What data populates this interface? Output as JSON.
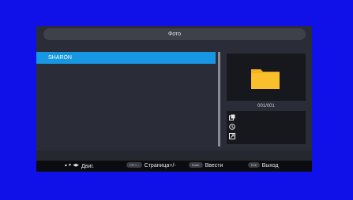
{
  "colors": {
    "background": "#1010e8",
    "panel": "#2a2d37",
    "selection": "#1696e3",
    "folder": "#f6b21b"
  },
  "title": "Фото",
  "file_list": {
    "items": [
      {
        "label": "SHARON",
        "selected": true
      }
    ]
  },
  "preview": {
    "icon": "folder-icon",
    "counter": "001/001"
  },
  "info_icons": [
    "slideshow-icon",
    "clock-icon",
    "resize-icon"
  ],
  "help_bar": {
    "move_keys": "▲▼ ◀▶",
    "move_label": "Двиг.",
    "page_key": "CH + -",
    "page_label": "Страница+/-",
    "enter_key": "Enter",
    "enter_label": "Ввести",
    "exit_key": "Exit",
    "exit_label": "Выход"
  }
}
